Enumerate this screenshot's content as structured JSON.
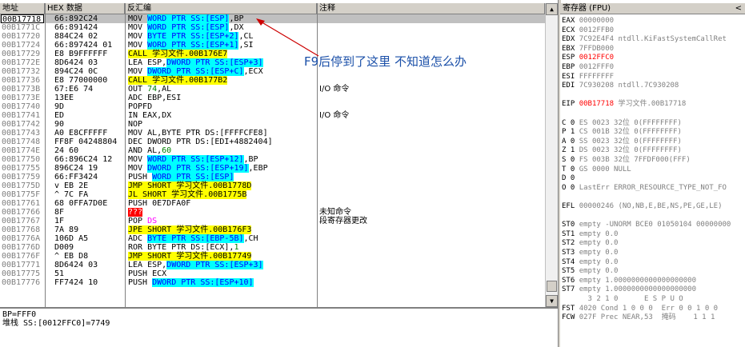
{
  "headers": {
    "address": "地址",
    "hex": "HEX 数据",
    "disasm": "反汇编",
    "comment": "注释",
    "registers": "寄存器 (FPU)"
  },
  "registers_close": "<",
  "rows": [
    {
      "addr": "00B17718",
      "hex": "66:892C24",
      "asm": [
        [
          "MOV ",
          ""
        ],
        [
          "WORD PTR SS:[ESP]",
          "cyan"
        ],
        [
          ",BP",
          ""
        ]
      ],
      "cmt": "",
      "sel": true
    },
    {
      "addr": "00B1771C",
      "hex": "66:891424",
      "asm": [
        [
          "MOV ",
          ""
        ],
        [
          "WORD PTR SS:[ESP]",
          "cyan"
        ],
        [
          ",DX",
          ""
        ]
      ],
      "cmt": ""
    },
    {
      "addr": "00B17720",
      "hex": "884C24 02",
      "asm": [
        [
          "MOV ",
          ""
        ],
        [
          "BYTE PTR SS:[ESP+2]",
          "cyan"
        ],
        [
          ",CL",
          ""
        ]
      ],
      "cmt": ""
    },
    {
      "addr": "00B17724",
      "hex": "66:897424 01",
      "asm": [
        [
          "MOV ",
          ""
        ],
        [
          "WORD PTR SS:[ESP+1]",
          "cyan"
        ],
        [
          ",SI",
          ""
        ]
      ],
      "cmt": ""
    },
    {
      "addr": "00B17729",
      "hex": "E8 B9FFFFFF",
      "asm": [
        [
          "CALL 学习文件.00B176E7",
          "yellow"
        ]
      ],
      "cmt": ""
    },
    {
      "addr": "00B1772E",
      "hex": "8D6424 03",
      "asm": [
        [
          "LEA ESP,",
          ""
        ],
        [
          "DWORD PTR SS:[ESP+3]",
          "cyan"
        ]
      ],
      "cmt": ""
    },
    {
      "addr": "00B17732",
      "hex": "894C24 0C",
      "asm": [
        [
          "MOV ",
          ""
        ],
        [
          "DWORD PTR SS:[ESP+C]",
          "cyan"
        ],
        [
          ",ECX",
          ""
        ]
      ],
      "cmt": ""
    },
    {
      "addr": "00B17736",
      "hex": "E8 77000000",
      "asm": [
        [
          "CALL 学习文件.00B177B2",
          "yellow"
        ]
      ],
      "cmt": ""
    },
    {
      "addr": "00B1773B",
      "hex": "67:E6 74",
      "asm": [
        [
          "OUT ",
          ""
        ],
        [
          "74",
          "green"
        ],
        [
          ",AL",
          ""
        ]
      ],
      "cmt": "I/O 命令"
    },
    {
      "addr": "00B1773E",
      "hex": "13EE",
      "asm": [
        [
          "ADC EBP,ESI",
          ""
        ]
      ],
      "cmt": ""
    },
    {
      "addr": "00B17740",
      "hex": "9D",
      "asm": [
        [
          "POPFD",
          ""
        ]
      ],
      "cmt": ""
    },
    {
      "addr": "00B17741",
      "hex": "ED",
      "asm": [
        [
          "IN EAX,DX",
          ""
        ]
      ],
      "cmt": "I/O 命令"
    },
    {
      "addr": "00B17742",
      "hex": "90",
      "asm": [
        [
          "NOP",
          ""
        ]
      ],
      "cmt": ""
    },
    {
      "addr": "00B17743",
      "hex": "A0 E8CFFFFF",
      "asm": [
        [
          "MOV AL,BYTE PTR DS:[FFFFCFE8]",
          ""
        ]
      ],
      "cmt": ""
    },
    {
      "addr": "00B17748",
      "hex": "FF8F 04248804",
      "asm": [
        [
          "DEC DWORD PTR DS:[EDI+4882404]",
          ""
        ]
      ],
      "cmt": ""
    },
    {
      "addr": "00B1774E",
      "hex": "24 60",
      "asm": [
        [
          "AND AL,",
          ""
        ],
        [
          "60",
          "green"
        ]
      ],
      "cmt": ""
    },
    {
      "addr": "00B17750",
      "hex": "66:896C24 12",
      "asm": [
        [
          "MOV ",
          ""
        ],
        [
          "WORD PTR SS:[ESP+12]",
          "cyan"
        ],
        [
          ",BP",
          ""
        ]
      ],
      "cmt": ""
    },
    {
      "addr": "00B17755",
      "hex": "896C24 19",
      "asm": [
        [
          "MOV ",
          ""
        ],
        [
          "DWORD PTR SS:[ESP+19]",
          "cyan"
        ],
        [
          ",EBP",
          ""
        ]
      ],
      "cmt": ""
    },
    {
      "addr": "00B17759",
      "hex": "66:FF3424",
      "asm": [
        [
          "PUSH ",
          ""
        ],
        [
          "WORD PTR SS:[ESP]",
          "cyan"
        ]
      ],
      "cmt": ""
    },
    {
      "addr": "00B1775D",
      "hex": "v EB 2E",
      "asm": [
        [
          "JMP SHORT 学习文件.00B1778D",
          "yellow"
        ]
      ],
      "cmt": ""
    },
    {
      "addr": "00B1775F",
      "hex": "^ 7C FA",
      "asm": [
        [
          "JL SHORT 学习文件.00B1775B",
          "yellow"
        ]
      ],
      "cmt": ""
    },
    {
      "addr": "00B17761",
      "hex": "68 0FFA7D0E",
      "asm": [
        [
          "PUSH 0E7DFA0F",
          ""
        ]
      ],
      "cmt": ""
    },
    {
      "addr": "00B17766",
      "hex": "8F",
      "asm": [
        [
          "???",
          "red"
        ]
      ],
      "cmt": "未知命令"
    },
    {
      "addr": "00B17767",
      "hex": "1F",
      "asm": [
        [
          "POP ",
          ""
        ],
        [
          "DS",
          "purple"
        ]
      ],
      "cmt": "段寄存器更改"
    },
    {
      "addr": "00B17768",
      "hex": "7A 89",
      "asm": [
        [
          "JPE SHORT 学习文件.00B176F3",
          "yellow"
        ]
      ],
      "cmt": ""
    },
    {
      "addr": "00B1776A",
      "hex": "106D A5",
      "asm": [
        [
          "ADC ",
          ""
        ],
        [
          "BYTE PTR SS:[EBP-5B]",
          "cyan"
        ],
        [
          ",CH",
          ""
        ]
      ],
      "cmt": ""
    },
    {
      "addr": "00B1776D",
      "hex": "D009",
      "asm": [
        [
          "ROR BYTE PTR DS:[ECX],",
          ""
        ],
        [
          "1",
          "green"
        ]
      ],
      "cmt": ""
    },
    {
      "addr": "00B1776F",
      "hex": "^ EB D8",
      "asm": [
        [
          "JMP SHORT 学习文件.00B17749",
          "yellow"
        ]
      ],
      "cmt": ""
    },
    {
      "addr": "00B17771",
      "hex": "8D6424 03",
      "asm": [
        [
          "LEA ESP,",
          ""
        ],
        [
          "DWORD PTR SS:[ESP+3]",
          "cyan"
        ]
      ],
      "cmt": ""
    },
    {
      "addr": "00B17775",
      "hex": "51",
      "asm": [
        [
          "PUSH ECX",
          ""
        ]
      ],
      "cmt": ""
    },
    {
      "addr": "00B17776",
      "hex": "FF7424 10",
      "asm": [
        [
          "PUSH ",
          ""
        ],
        [
          "DWORD PTR SS:[ESP+10]",
          "cyan"
        ]
      ],
      "cmt": ""
    }
  ],
  "annotation": "F9后停到了这里 不知道怎么办",
  "info": {
    "line1": "BP=FFF0",
    "line2": "堆栈 SS:[0012FFC0]=7749"
  },
  "registers": [
    {
      "n": "EAX",
      "v": "00000000",
      "extra": ""
    },
    {
      "n": "ECX",
      "v": "0012FFB0",
      "extra": ""
    },
    {
      "n": "EDX",
      "v": "7C92E4F4",
      "extra": "ntdll.KiFastSystemCallRet"
    },
    {
      "n": "EBX",
      "v": "7FFDB000",
      "extra": ""
    },
    {
      "n": "ESP",
      "v": "0012FFC0",
      "extra": "",
      "red": true
    },
    {
      "n": "EBP",
      "v": "0012FFF0",
      "extra": ""
    },
    {
      "n": "ESI",
      "v": "FFFFFFFF",
      "extra": ""
    },
    {
      "n": "EDI",
      "v": "7C930208",
      "extra": "ntdll.7C930208"
    },
    {
      "n": "",
      "v": "",
      "extra": ""
    },
    {
      "n": "EIP",
      "v": "00B17718",
      "extra": "学习文件.00B17718",
      "red": true
    },
    {
      "n": "",
      "v": "",
      "extra": ""
    },
    {
      "n": "C 0",
      "v": "ES 0023",
      "extra": "32位 0(FFFFFFFF)"
    },
    {
      "n": "P 1",
      "v": "CS 001B",
      "extra": "32位 0(FFFFFFFF)"
    },
    {
      "n": "A 0",
      "v": "SS 0023",
      "extra": "32位 0(FFFFFFFF)"
    },
    {
      "n": "Z 1",
      "v": "DS 0023",
      "extra": "32位 0(FFFFFFFF)"
    },
    {
      "n": "S 0",
      "v": "FS 003B",
      "extra": "32位 7FFDF000(FFF)"
    },
    {
      "n": "T 0",
      "v": "GS 0000",
      "extra": "NULL"
    },
    {
      "n": "D 0",
      "v": "",
      "extra": ""
    },
    {
      "n": "O 0",
      "v": "LastErr",
      "extra": "ERROR_RESOURCE_TYPE_NOT_FO"
    },
    {
      "n": "",
      "v": "",
      "extra": ""
    },
    {
      "n": "EFL",
      "v": "00000246",
      "extra": "(NO,NB,E,BE,NS,PE,GE,LE)"
    },
    {
      "n": "",
      "v": "",
      "extra": ""
    },
    {
      "n": "ST0",
      "v": "empty",
      "extra": "-UNORM BCE0 01050104 00000000"
    },
    {
      "n": "ST1",
      "v": "empty",
      "extra": "0.0"
    },
    {
      "n": "ST2",
      "v": "empty",
      "extra": "0.0"
    },
    {
      "n": "ST3",
      "v": "empty",
      "extra": "0.0"
    },
    {
      "n": "ST4",
      "v": "empty",
      "extra": "0.0"
    },
    {
      "n": "ST5",
      "v": "empty",
      "extra": "0.0"
    },
    {
      "n": "ST6",
      "v": "empty",
      "extra": "1.0000000000000000000"
    },
    {
      "n": "ST7",
      "v": "empty",
      "extra": "1.0000000000000000000"
    },
    {
      "n": "",
      "v": "",
      "extra": "      3 2 1 0      E S P U O"
    },
    {
      "n": "FST",
      "v": "4020",
      "extra": "Cond 1 0 0 0  Err 0 0 1 0 0"
    },
    {
      "n": "FCW",
      "v": "027F",
      "extra": "Prec NEAR,53  掩码    1 1 1"
    }
  ],
  "scroll": {
    "up": "▲",
    "down": "▼"
  }
}
